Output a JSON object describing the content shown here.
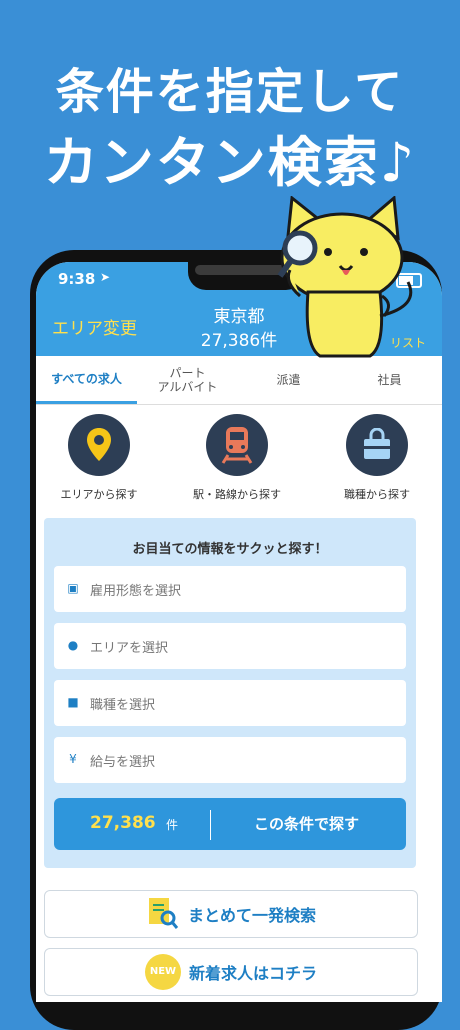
{
  "promo": {
    "line1": "条件を指定して",
    "line2": "カンタン検索♪"
  },
  "status_bar": {
    "time": "9:38"
  },
  "header": {
    "area_change": "エリア変更",
    "city": "東京都",
    "count": "27,386件",
    "list_label": "リスト"
  },
  "tabs": [
    {
      "label": "すべての求人",
      "active": true
    },
    {
      "label": "パート\nアルバイト",
      "active": false
    },
    {
      "label": "派遣",
      "active": false
    },
    {
      "label": "社員",
      "active": false
    }
  ],
  "categories": [
    {
      "label": "エリアから探す",
      "icon": "map-pin-icon"
    },
    {
      "label": "駅・路線から探す",
      "icon": "train-icon"
    },
    {
      "label": "職種から探す",
      "icon": "bag-icon"
    }
  ],
  "search_panel": {
    "title": "お目当ての情報をサクッと探す！",
    "fields": [
      {
        "placeholder": "雇用形態を選択",
        "icon": "employment-icon"
      },
      {
        "placeholder": "エリアを選択",
        "icon": "location-icon"
      },
      {
        "placeholder": "職種を選択",
        "icon": "bag-icon"
      },
      {
        "placeholder": "給与を選択",
        "icon": "yen-icon"
      }
    ],
    "result_count": "27,386",
    "result_unit": "件",
    "search_label": "この条件で探す"
  },
  "buttons": {
    "bulk_search": "まとめて一発検索",
    "new_jobs": "新着求人はコチラ",
    "new_badge": "NEW"
  },
  "colors": {
    "background": "#3a8fd6",
    "header": "#3aa0e2",
    "accent_yellow": "#ffe04d",
    "panel": "#cfe7fa",
    "icon_circle": "#2d3e55"
  }
}
